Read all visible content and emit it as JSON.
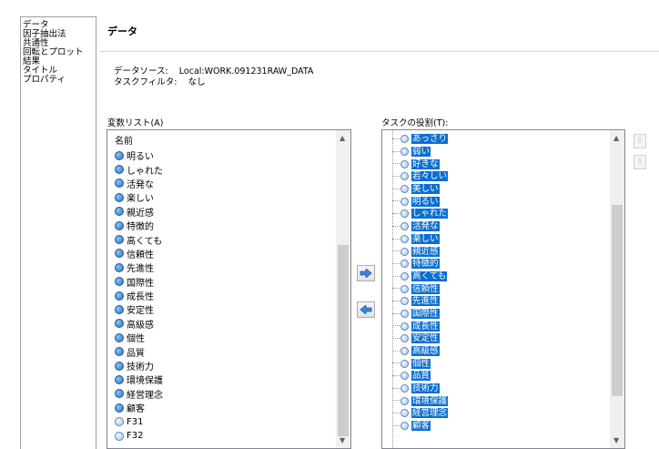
{
  "nav": {
    "items": [
      "データ",
      "因子抽出法",
      "共通性",
      "回転とプロット",
      "結果",
      "タイトル",
      "プロパティ"
    ]
  },
  "page": {
    "title": "データ",
    "data_source_label": "データソース:",
    "data_source_value": "Local:WORK.091231RAW_DATA",
    "task_filter_label": "タスクフィルタ:",
    "task_filter_value": "なし"
  },
  "variable_list": {
    "label": "変数リスト(A)",
    "header": "名前",
    "items": [
      {
        "name": "明るい",
        "type": "char"
      },
      {
        "name": "しゃれた",
        "type": "char"
      },
      {
        "name": "活発な",
        "type": "char"
      },
      {
        "name": "楽しい",
        "type": "char"
      },
      {
        "name": "親近感",
        "type": "char"
      },
      {
        "name": "特徴的",
        "type": "char"
      },
      {
        "name": "高くても",
        "type": "char"
      },
      {
        "name": "信頼性",
        "type": "char"
      },
      {
        "name": "先進性",
        "type": "char"
      },
      {
        "name": "国際性",
        "type": "char"
      },
      {
        "name": "成長性",
        "type": "char"
      },
      {
        "name": "安定性",
        "type": "char"
      },
      {
        "name": "高級感",
        "type": "char"
      },
      {
        "name": "個性",
        "type": "char"
      },
      {
        "name": "品質",
        "type": "char"
      },
      {
        "name": "技術力",
        "type": "char"
      },
      {
        "name": "環境保護",
        "type": "char"
      },
      {
        "name": "経営理念",
        "type": "char"
      },
      {
        "name": "顧客",
        "type": "char"
      },
      {
        "name": "F31",
        "type": "num"
      },
      {
        "name": "F32",
        "type": "num"
      }
    ]
  },
  "task_roles": {
    "label": "タスクの役割(T):",
    "items": [
      "あっさり",
      "弱い",
      "好きな",
      "若々しい",
      "美しい",
      "明るい",
      "しゃれた",
      "活発な",
      "楽しい",
      "親近感",
      "特徴的",
      "高くても",
      "信頼性",
      "先進性",
      "国際性",
      "成長性",
      "安定性",
      "高級感",
      "個性",
      "品質",
      "技術力",
      "環境保護",
      "経営理念",
      "顧客"
    ]
  },
  "icons": {
    "add": "right-arrow-icon",
    "remove": "left-arrow-icon",
    "move_up": "up-arrow-icon",
    "move_down": "down-arrow-icon",
    "scroll_up": "▲",
    "scroll_down": "▼"
  },
  "colors": {
    "selection": "#0b6fd1",
    "arrow_button_icon": "#3b86d6"
  }
}
